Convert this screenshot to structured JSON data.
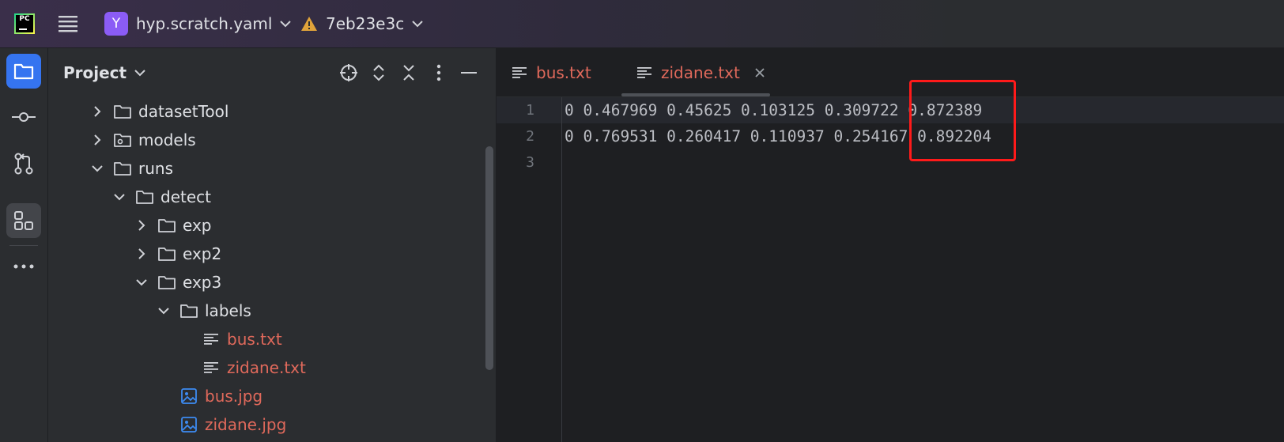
{
  "titlebar": {
    "logo": "PC",
    "project_badge": "Y",
    "project_name": "hyp.scratch.yaml",
    "commit": "7eb23e3c"
  },
  "toolstrip": {
    "icons": [
      "folder-icon",
      "commit-icon",
      "pull-request-icon",
      "structure-icon",
      "more-icon"
    ]
  },
  "project_panel": {
    "title": "Project",
    "tree": [
      {
        "label": "datasetTool",
        "type": "folder",
        "expanded": false
      },
      {
        "label": "models",
        "type": "package",
        "expanded": false
      },
      {
        "label": "runs",
        "type": "folder",
        "expanded": true
      },
      {
        "label": "detect",
        "type": "folder",
        "expanded": true
      },
      {
        "label": "exp",
        "type": "folder",
        "expanded": false
      },
      {
        "label": "exp2",
        "type": "folder",
        "expanded": false
      },
      {
        "label": "exp3",
        "type": "folder",
        "expanded": true
      },
      {
        "label": "labels",
        "type": "folder",
        "expanded": true
      },
      {
        "label": "bus.txt",
        "type": "text-file"
      },
      {
        "label": "zidane.txt",
        "type": "text-file"
      },
      {
        "label": "bus.jpg",
        "type": "image-file"
      },
      {
        "label": "zidane.jpg",
        "type": "image-file"
      }
    ]
  },
  "editor": {
    "tabs": [
      {
        "label": "bus.txt",
        "active": false
      },
      {
        "label": "zidane.txt",
        "active": true
      }
    ],
    "line_numbers": [
      "1",
      "2",
      "3"
    ],
    "lines": [
      "0 0.467969 0.45625 0.103125 0.309722 0.872389",
      "0 0.769531 0.260417 0.110937 0.254167 0.892204",
      ""
    ]
  },
  "colors": {
    "accent": "#3574f0",
    "modified_file": "#e0695b",
    "highlight_box": "#ff1a1a"
  }
}
